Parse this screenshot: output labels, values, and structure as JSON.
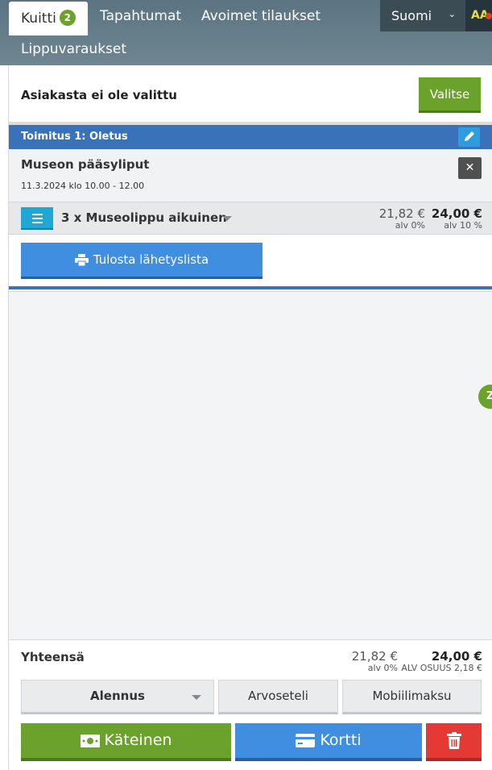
{
  "nav": {
    "tabs": [
      {
        "label": "Kuitti",
        "badge": "2"
      },
      {
        "label": "Tapahtumat"
      },
      {
        "label": "Avoimet tilaukset"
      },
      {
        "label": "Lippuvaraukset"
      }
    ],
    "language": "Suomi",
    "accessibility": "AA"
  },
  "customer": {
    "label": "Asiakasta ei ole valittu",
    "select_button": "Valitse"
  },
  "delivery": {
    "title": "Toimitus 1: Oletus"
  },
  "event": {
    "name": "Museon pääsyliput",
    "time": "11.3.2024 klo 10.00 - 12.00"
  },
  "item": {
    "name": "3 x Museolippu aikuinen",
    "net_price": "21,82 €",
    "net_vat": "alv 0%",
    "gross_price": "24,00 €",
    "gross_vat": "alv 10 %"
  },
  "print_button": "Tulosta lähetyslista",
  "side_chip": "Z",
  "totals": {
    "label": "Yhteensä",
    "net": "21,82 €",
    "net_vat": "alv 0%",
    "gross": "24,00 €",
    "gross_vat": "ALV OSUUS 2,18 €"
  },
  "actions": {
    "discount": "Alennus",
    "voucher": "Arvoseteli",
    "mobile": "Mobiilimaksu",
    "cash": "Käteinen",
    "card": "Kortti"
  },
  "colors": {
    "green": "#6aa22c",
    "blue": "#3f8ee0",
    "dark_blue": "#3a72ba",
    "red": "#e53935",
    "nav": "#5c7482"
  }
}
